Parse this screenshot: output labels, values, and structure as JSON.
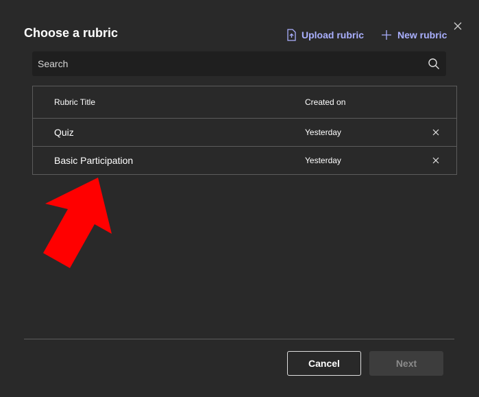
{
  "dialog": {
    "title": "Choose a rubric",
    "upload_label": "Upload rubric",
    "new_label": "New rubric"
  },
  "search": {
    "placeholder": "Search"
  },
  "table": {
    "columns": {
      "title": "Rubric Title",
      "created": "Created on"
    },
    "rows": [
      {
        "title": "Quiz",
        "created": "Yesterday"
      },
      {
        "title": "Basic Participation",
        "created": "Yesterday"
      }
    ]
  },
  "footer": {
    "cancel_label": "Cancel",
    "next_label": "Next"
  },
  "colors": {
    "background": "#292929",
    "accent": "#aab0ff",
    "annotation_arrow": "#ff0000"
  },
  "icons": {
    "close": "close-icon",
    "upload": "upload-file-icon",
    "new": "plus-icon",
    "search": "search-icon",
    "remove": "remove-x-icon"
  }
}
